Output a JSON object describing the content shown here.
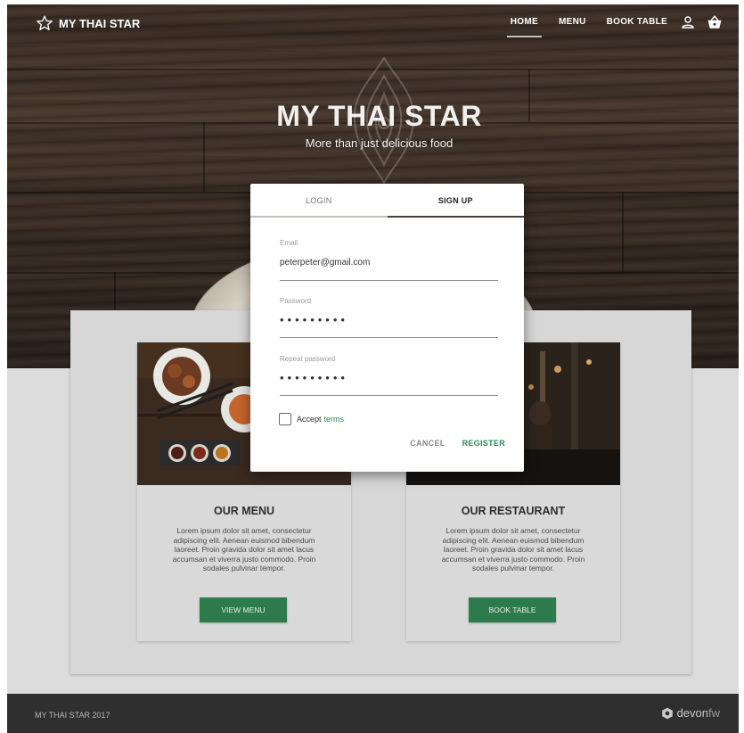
{
  "app": {
    "brand": "MY THAI STAR",
    "hero_title": "MY THAI STAR",
    "hero_subtitle": "More than just delicious food"
  },
  "nav": {
    "items": [
      {
        "label": "HOME",
        "active": true
      },
      {
        "label": "MENU",
        "active": false
      },
      {
        "label": "BOOK TABLE",
        "active": false
      }
    ],
    "icons": [
      "user-icon",
      "basket-icon"
    ]
  },
  "dialog": {
    "tabs": [
      {
        "label": "LOGIN",
        "active": false
      },
      {
        "label": "SIGN UP",
        "active": true
      }
    ],
    "email": {
      "label": "Email",
      "value": "peterpeter@gmail.com"
    },
    "password": {
      "label": "Password",
      "value": "•••••••••"
    },
    "repeat_password": {
      "label": "Repeat password",
      "value": "•••••••••"
    },
    "accept_text": "Accept",
    "terms_link": "terms",
    "cancel_label": "CANCEL",
    "register_label": "REGISTER"
  },
  "cards": [
    {
      "title": "OUR MENU",
      "text": "Lorem ipsum dolor sit amet, consectetur adipiscing elit. Aenean euismod bibendum laoreet. Proin gravida dolor sit amet lacus accumsan et viverra justo commodo. Proin sodales pulvinar tempor.",
      "button": "VIEW MENU"
    },
    {
      "title": "OUR RESTAURANT",
      "text": "Lorem ipsum dolor sit amet, consectetur adipiscing elit. Aenean euismod bibendum laoreet. Proin gravida dolor sit amet lacus accumsan et viverra justo commodo. Proin sodales pulvinar tempor.",
      "button": "BOOK TABLE"
    }
  ],
  "footer": {
    "copyright": "MY THAI STAR 2017",
    "logo_strong": "devon",
    "logo_light": "fw"
  },
  "colors": {
    "accent_green": "#2d7a4c",
    "link_green": "#2a8a57",
    "footer_bg": "#2f2f2f"
  }
}
